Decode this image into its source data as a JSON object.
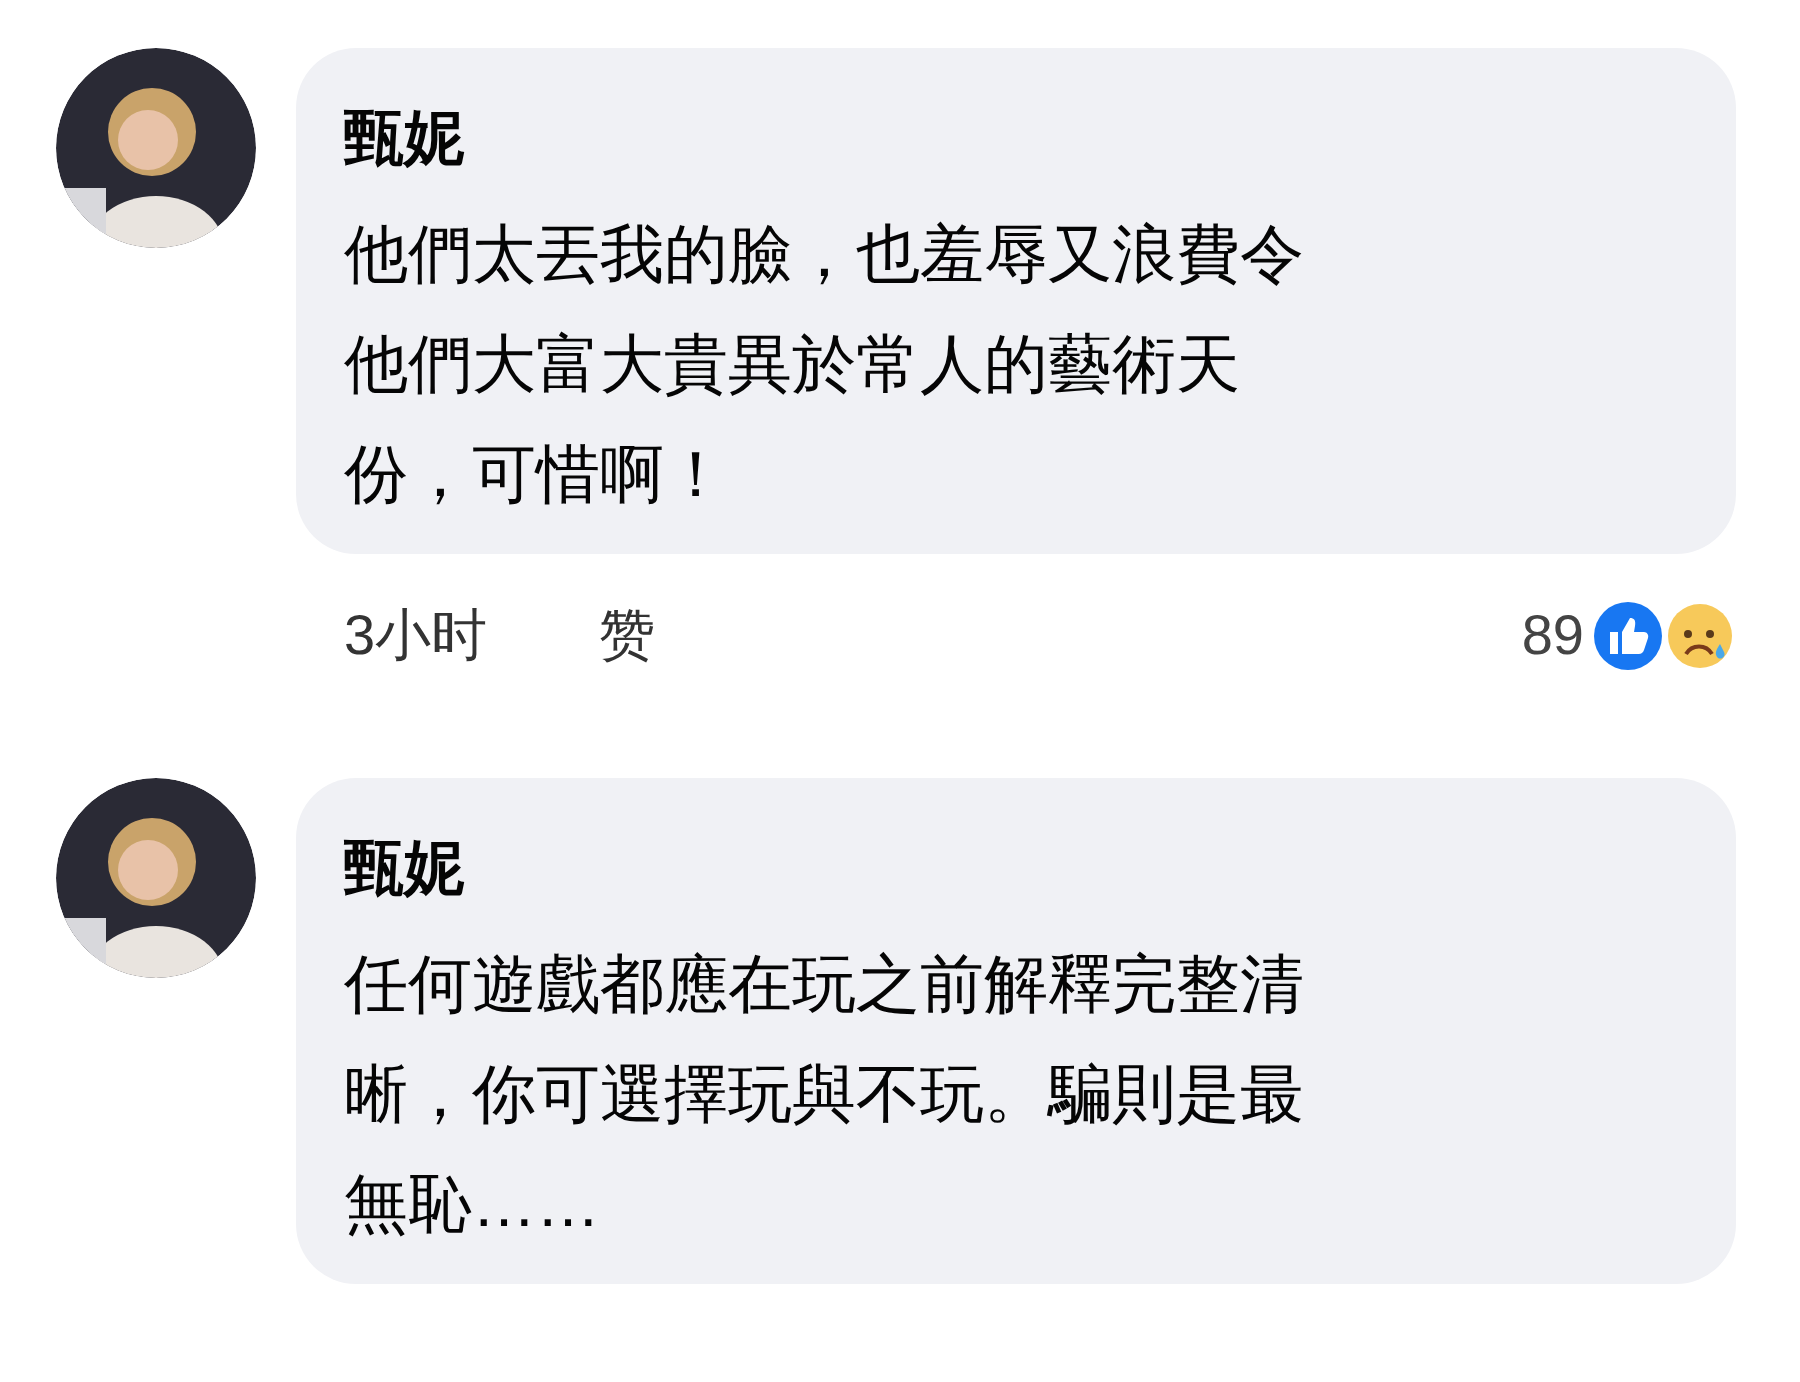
{
  "comments": [
    {
      "author": "甄妮",
      "text": "他們太丟我的臉，也羞辱又浪費令他們大富大貴異於常人的藝術天份，可惜啊！",
      "time": "3小时",
      "like_label": "赞",
      "reaction_count": "89"
    },
    {
      "author": "甄妮",
      "text": "任何遊戲都應在玩之前解釋完整清晰，你可選擇玩與不玩。騙則是最無恥……"
    }
  ]
}
